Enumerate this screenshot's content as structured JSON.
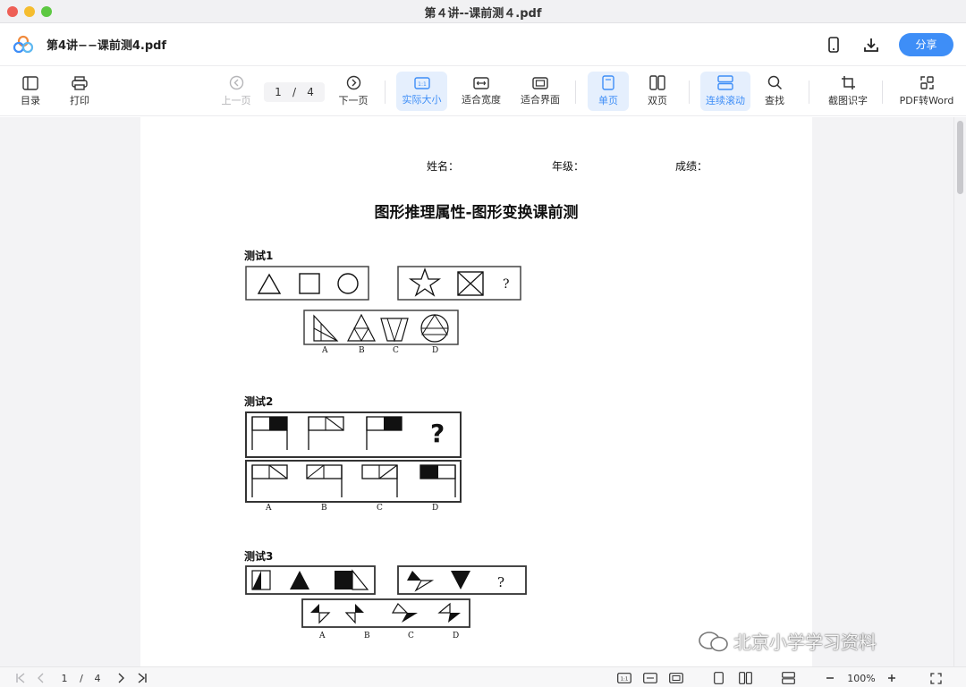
{
  "window": {
    "title": "第４讲--课前测４.pdf",
    "traffic": [
      "#ee5f56",
      "#f5bd2f",
      "#5dc842"
    ]
  },
  "header": {
    "doc_name": "第4讲−−课前测4.pdf",
    "share_label": "分享"
  },
  "toolbar": {
    "toc": "目录",
    "print": "打印",
    "prev_page": "上一页",
    "next_page": "下一页",
    "page_current": "1",
    "page_sep": "/",
    "page_total": "4",
    "actual_size": "实际大小",
    "fit_width": "适合宽度",
    "fit_page": "适合界面",
    "single_page": "单页",
    "double_page": "双页",
    "continuous_scroll": "连续滚动",
    "find": "查找",
    "ocr": "截图识字",
    "pdf_to_word": "PDF转Word"
  },
  "document": {
    "name_label": "姓名：",
    "grade_label": "年级：",
    "score_label": "成绩：",
    "title": "图形推理属性-图形变换课前测",
    "questions": [
      {
        "label": "测试1",
        "options": [
          "A",
          "B",
          "C",
          "D"
        ],
        "question_mark": "?"
      },
      {
        "label": "测试2",
        "options": [
          "A",
          "B",
          "C",
          "D"
        ],
        "question_mark": "?"
      },
      {
        "label": "测试3",
        "options": [
          "A",
          "B",
          "C",
          "D"
        ],
        "question_mark": "?"
      }
    ]
  },
  "statusbar": {
    "page_current": "1",
    "page_sep": "/",
    "page_total": "4",
    "zoom": "100%",
    "one_to_one": "1:1"
  },
  "watermark": {
    "text": "北京小学学习资料"
  },
  "colors": {
    "accent": "#3e8ef7",
    "active_bg": "#e5effd"
  }
}
